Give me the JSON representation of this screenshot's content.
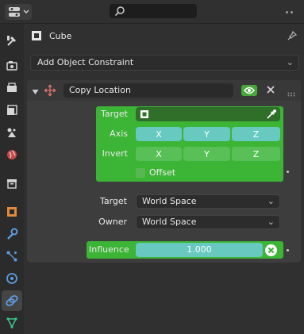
{
  "header": {
    "editor_type_icon": "properties-editor-icon",
    "search_icon": "search-icon"
  },
  "tabs": [
    {
      "icon": "tool-icon",
      "label": "Tool"
    },
    {
      "icon": "render-icon",
      "label": "Render"
    },
    {
      "icon": "output-icon",
      "label": "Output"
    },
    {
      "icon": "view-layer-icon",
      "label": "View Layer"
    },
    {
      "icon": "scene-icon",
      "label": "Scene"
    },
    {
      "icon": "world-icon",
      "label": "World"
    },
    {
      "icon": "collection-icon",
      "label": "Collection"
    },
    {
      "icon": "object-icon",
      "label": "Object"
    },
    {
      "icon": "modifier-icon",
      "label": "Modifiers"
    },
    {
      "icon": "particles-icon",
      "label": "Particles"
    },
    {
      "icon": "physics-icon",
      "label": "Physics"
    },
    {
      "icon": "constraints-icon",
      "label": "Object Constraints",
      "active": true
    },
    {
      "icon": "object-data-icon",
      "label": "Data"
    }
  ],
  "object": {
    "name": "Cube"
  },
  "add_constraint": {
    "label": "Add Object Constraint"
  },
  "constraint": {
    "name": "Copy Location",
    "target_label": "Target",
    "axis_label": "Axis",
    "axis": [
      "X",
      "Y",
      "Z"
    ],
    "invert_label": "Invert",
    "invert": [
      "X",
      "Y",
      "Z"
    ],
    "offset_label": "Offset",
    "target_space_label": "Target",
    "target_space_value": "World Space",
    "owner_space_label": "Owner",
    "owner_space_value": "World Space",
    "influence_label": "Influence",
    "influence_value": "1.000"
  },
  "colors": {
    "accent_green": "#3cb435",
    "axis_teal": "#67c9bf",
    "panel_bg": "#3d3d3d"
  }
}
